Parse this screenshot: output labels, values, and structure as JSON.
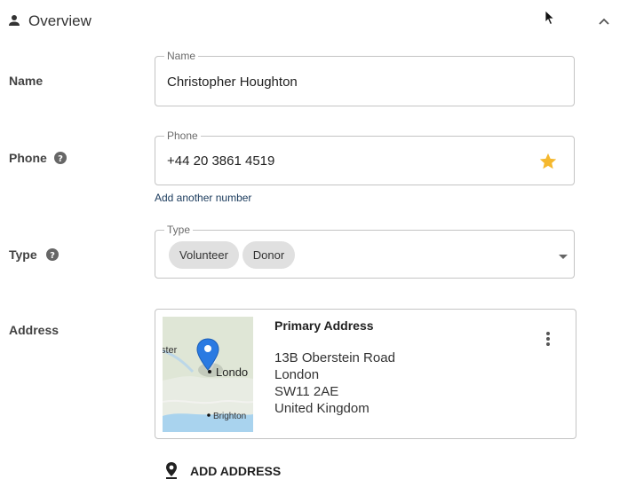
{
  "header": {
    "title": "Overview",
    "person_icon": "person-icon",
    "collapse_icon": "chevron-up-icon"
  },
  "name": {
    "label": "Name",
    "field_legend": "Name",
    "value": "Christopher Houghton"
  },
  "phone": {
    "label": "Phone",
    "help_icon": "help-circle-icon",
    "field_legend": "Phone",
    "value": "+44 20 3861 4519",
    "star_icon": "star-icon",
    "star_color": "#f5b82e",
    "add_another": "Add another number"
  },
  "type": {
    "label": "Type",
    "help_icon": "help-circle-icon",
    "field_legend": "Type",
    "chips": [
      "Volunteer",
      "Donor"
    ],
    "dropdown_icon": "caret-down-icon"
  },
  "address": {
    "label": "Address",
    "card_title": "Primary Address",
    "lines": [
      "13B Oberstein Road",
      "London",
      "SW11 2AE",
      "United Kingdom"
    ],
    "map": {
      "labels": [
        "ster",
        "Londo",
        "Brighton"
      ],
      "pin_color": "#2a7ae2"
    },
    "more_icon": "more-vertical-icon"
  },
  "add_address": {
    "label": "ADD ADDRESS",
    "icon": "map-pin-icon"
  },
  "colors": {
    "link": "#1a3a5c",
    "border": "#c4c4c4",
    "chip_bg": "#e0e0e0"
  }
}
